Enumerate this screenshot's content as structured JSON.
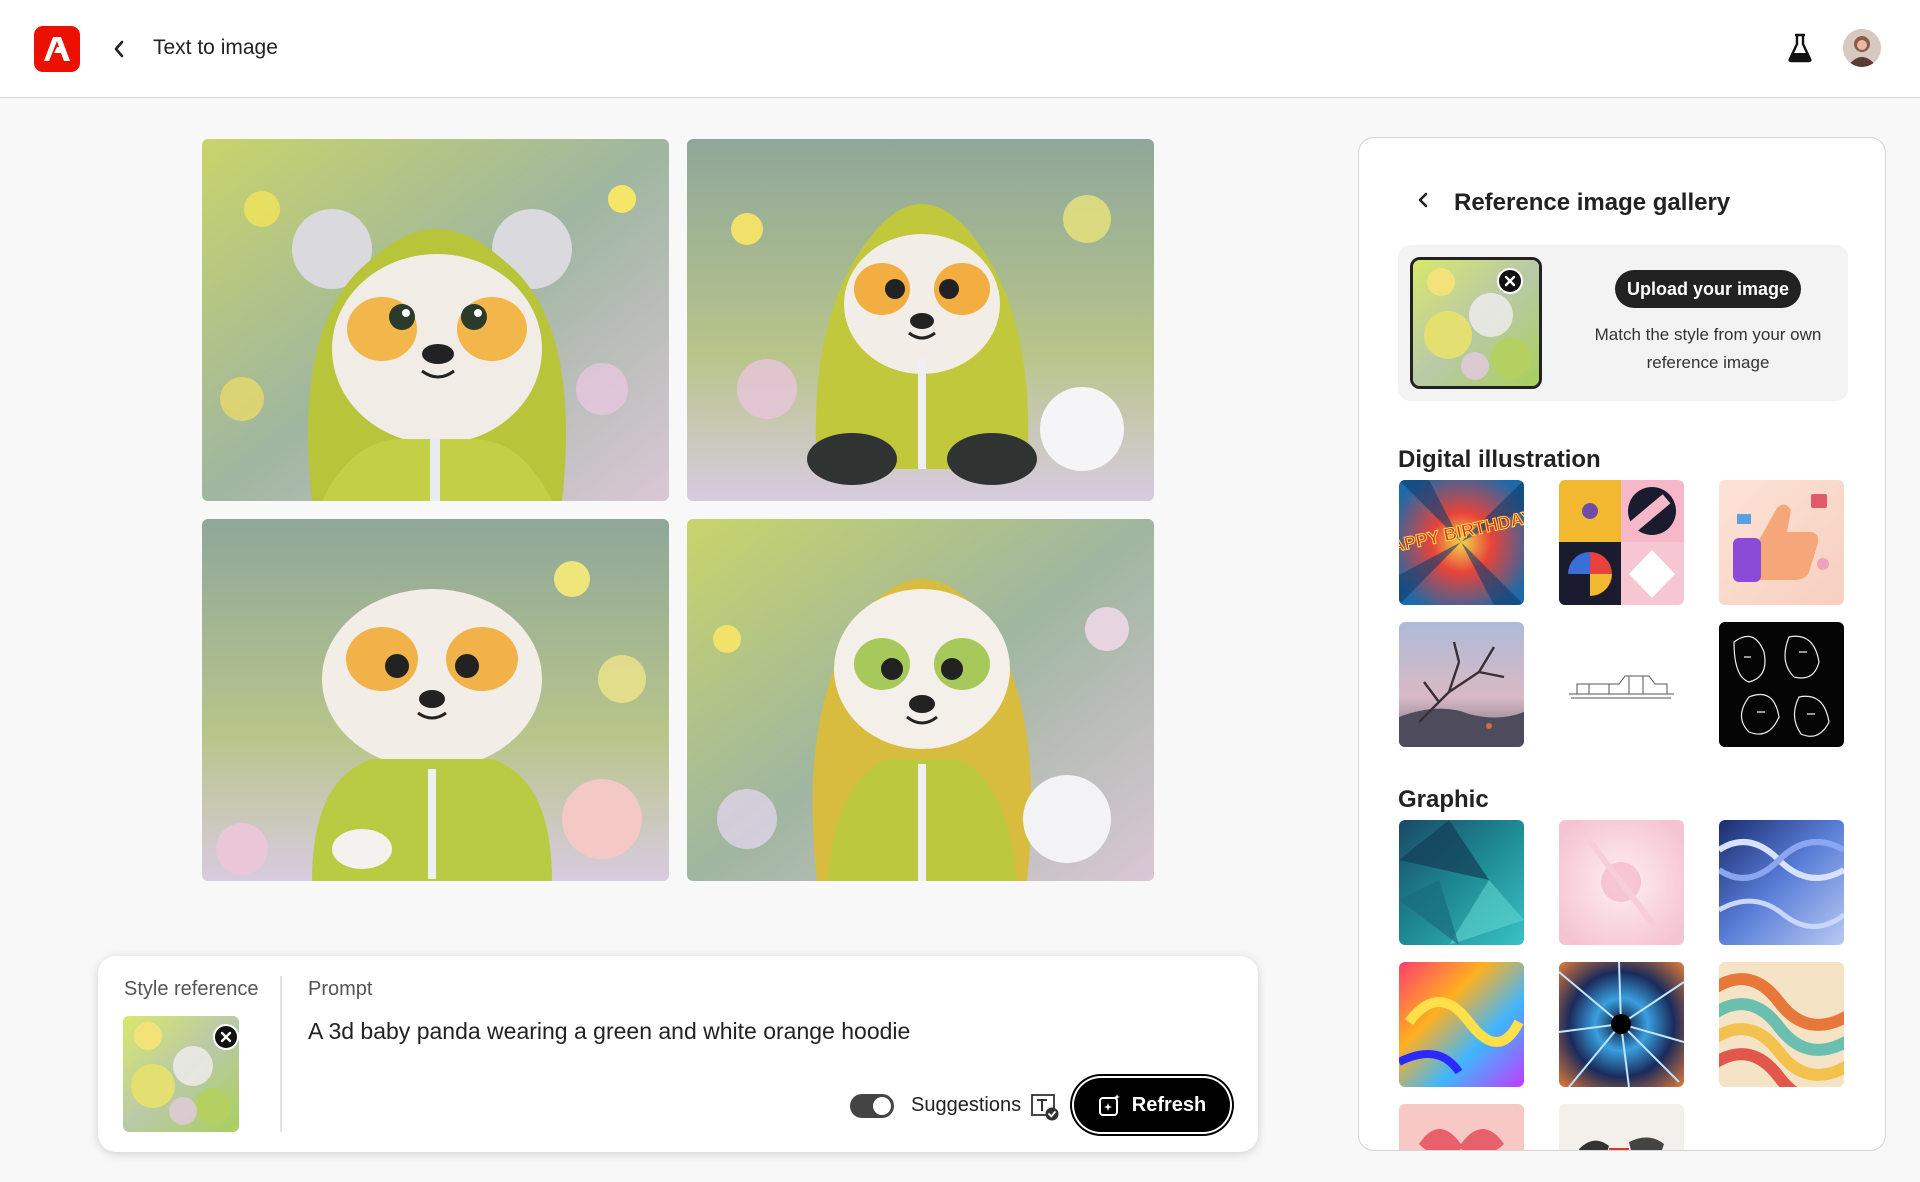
{
  "header": {
    "title": "Text to image"
  },
  "results": {
    "images": [
      "panda-result-1",
      "panda-result-2",
      "panda-result-3",
      "panda-result-4"
    ]
  },
  "prompt_panel": {
    "style_reference_label": "Style reference",
    "prompt_label": "Prompt",
    "prompt_text": "A 3d baby panda wearing a green and white orange hoodie",
    "suggestions_label": "Suggestions",
    "suggestions_enabled": true,
    "refresh_label": "Refresh"
  },
  "gallery": {
    "title": "Reference image gallery",
    "upload_button": "Upload your image",
    "upload_description": "Match the style from your own reference image",
    "sections": [
      {
        "title": "Digital illustration",
        "items": [
          "happy-birthday-comic",
          "geometric-shapes",
          "thumbs-up-3d",
          "landscape-branches",
          "line-sketch-building",
          "line-art-faces"
        ],
        "thumb_text": "HAPPY BIRTHDAY!"
      },
      {
        "title": "Graphic",
        "items": [
          "teal-polygon",
          "pink-abstract",
          "blue-dna",
          "colorful-swirl",
          "hyperspace-burst",
          "retro-waves",
          "pink-pattern",
          "partial-thumb"
        ]
      }
    ]
  },
  "colors": {
    "brand_red": "#eb1000",
    "dark": "#000000",
    "panel_bg": "#ffffff",
    "page_bg": "#f8f8f8"
  }
}
